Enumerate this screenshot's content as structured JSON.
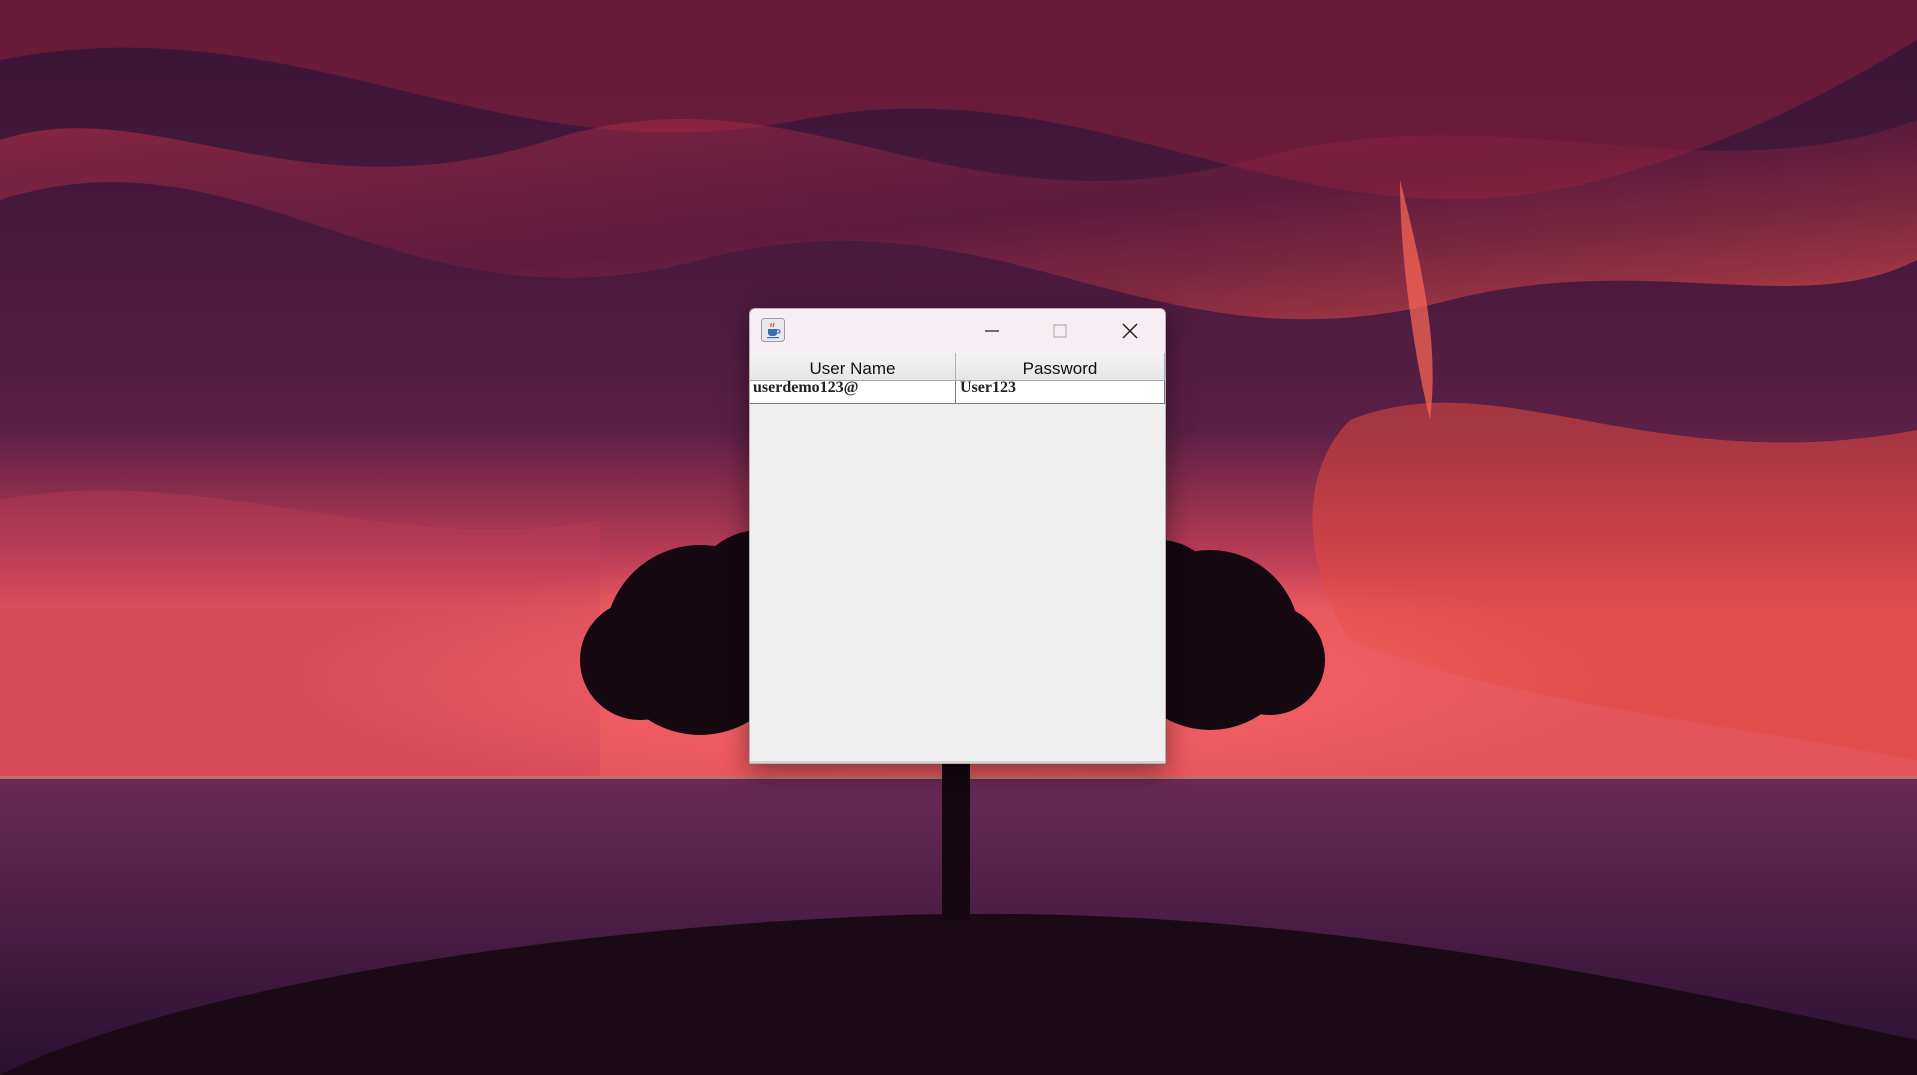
{
  "window": {
    "title": "",
    "app_icon": "java-coffee-cup-icon",
    "controls": {
      "minimize_icon": "minimize-icon",
      "maximize_icon": "maximize-icon",
      "close_icon": "close-icon"
    }
  },
  "table": {
    "columns": [
      "User Name",
      "Password"
    ],
    "rows": [
      [
        "userdemo123@",
        "User123"
      ]
    ]
  },
  "colors": {
    "title_bar": "#f6eef2",
    "window_body": "#efefef",
    "cell_background": "#ffffff"
  }
}
